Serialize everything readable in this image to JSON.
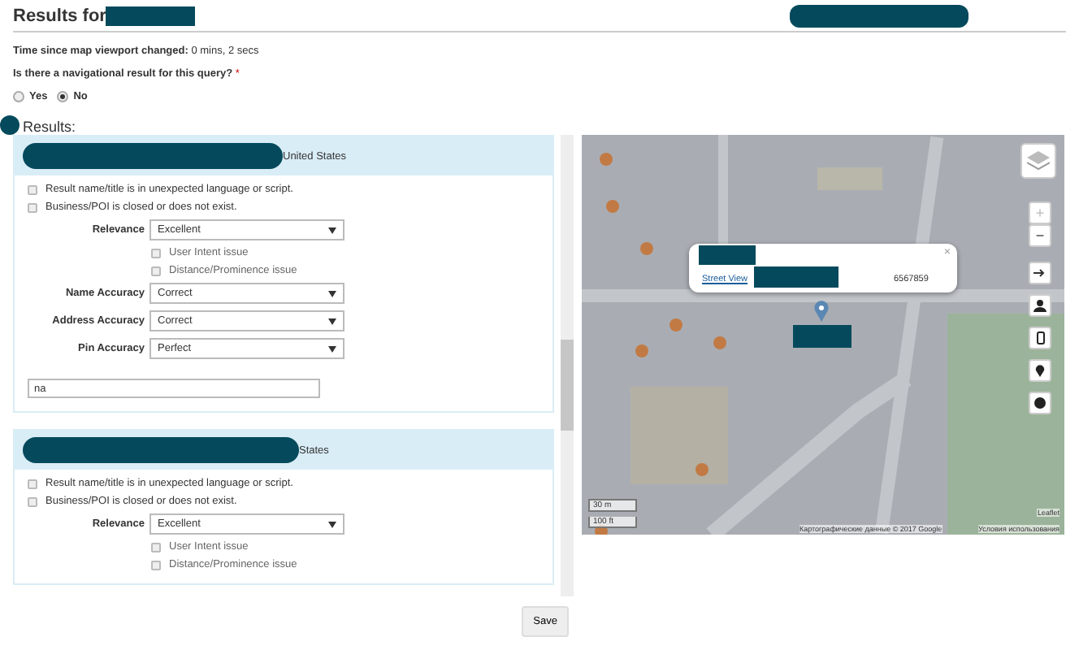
{
  "page": {
    "title": "Results for",
    "timer_label": "Time since map viewport changed:",
    "timer_value": "0 mins, 2 secs",
    "question": "Is there a navigational result for this query?",
    "required_mark": "*",
    "results_heading": "Results:"
  },
  "options": [
    {
      "label": "Yes",
      "selected": false
    },
    {
      "label": "No",
      "selected": true
    }
  ],
  "results": [
    {
      "location": "United States",
      "flags": [
        {
          "label": "Result name/title is in unexpected language or script.",
          "checked": false
        },
        {
          "label": "Business/POI is closed or does not exist.",
          "checked": false
        }
      ],
      "relevance": {
        "label": "Relevance",
        "value": "Excellent"
      },
      "issues": [
        {
          "label": "User Intent issue",
          "checked": false
        },
        {
          "label": "Distance/Prominence issue",
          "checked": false
        }
      ],
      "accuracy": [
        {
          "label": "Name Accuracy",
          "value": "Correct"
        },
        {
          "label": "Address Accuracy",
          "value": "Correct"
        },
        {
          "label": "Pin Accuracy",
          "value": "Perfect"
        }
      ],
      "comment": "na"
    },
    {
      "location": "States",
      "flags": [
        {
          "label": "Result name/title is in unexpected language or script.",
          "checked": false
        },
        {
          "label": "Business/POI is closed or does not exist.",
          "checked": false
        }
      ],
      "relevance": {
        "label": "Relevance",
        "value": "Excellent"
      },
      "issues": [
        {
          "label": "User Intent issue",
          "checked": false
        },
        {
          "label": "Distance/Prominence issue",
          "checked": false
        }
      ]
    }
  ],
  "map": {
    "popup": {
      "link": "Street View",
      "text": "6567859",
      "close": "×"
    },
    "zoom": [
      {
        "label": "+",
        "disabled": true
      },
      {
        "label": "−",
        "disabled": false
      }
    ],
    "scale": [
      "30 m",
      "100 ft"
    ],
    "leaflet": "Leaflet",
    "attribution": "Картографические данные © 2017 Google",
    "terms": "Условия использования"
  },
  "save": "Save"
}
